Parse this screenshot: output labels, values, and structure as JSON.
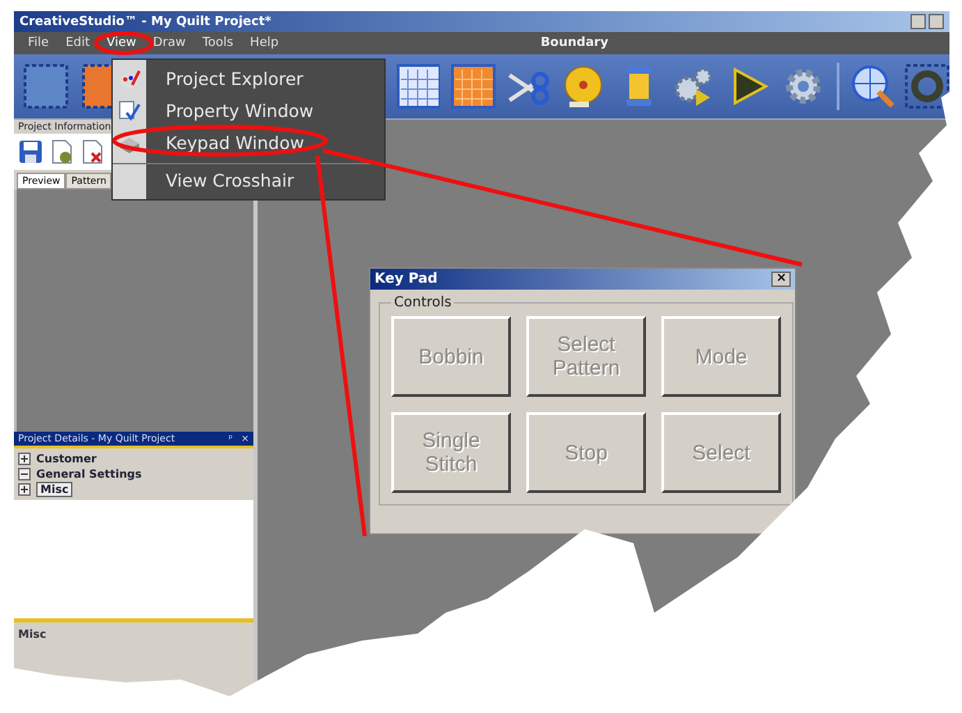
{
  "window": {
    "title": "CreativeStudio™ - My Quilt Project*"
  },
  "menu": [
    {
      "label": "File",
      "selected": false
    },
    {
      "label": "Edit",
      "selected": false
    },
    {
      "label": "View",
      "selected": true
    },
    {
      "label": "Draw",
      "selected": false
    },
    {
      "label": "Tools",
      "selected": false
    },
    {
      "label": "Help",
      "selected": false
    }
  ],
  "toolbar_caption": "Boundary",
  "view_menu": [
    {
      "label": "Project Explorer",
      "kind": "palette"
    },
    {
      "label": "Property Window",
      "kind": "property"
    },
    {
      "label": "Keypad Window",
      "kind": "keypad"
    },
    {
      "label": "View Crosshair",
      "kind": "plain"
    }
  ],
  "project_panel": {
    "title": "Project Information",
    "tabs": [
      {
        "label": "Preview",
        "selected": true
      },
      {
        "label": "Pattern",
        "selected": false
      }
    ]
  },
  "details_panel": {
    "title": "Project Details - My Quilt Project",
    "pin": "ᵖ",
    "close": "×",
    "items": [
      {
        "label": "Customer",
        "expanded": false,
        "selected": false
      },
      {
        "label": "General Settings",
        "expanded": true,
        "selected": false
      },
      {
        "label": "Misc",
        "expanded": false,
        "selected": true
      }
    ],
    "footer": "Misc"
  },
  "keypad": {
    "title": "Key Pad",
    "close": "×",
    "group": "Controls",
    "buttons": [
      {
        "label": "Bobbin",
        "disabled": true
      },
      {
        "label": "Select Pattern",
        "disabled": true
      },
      {
        "label": "Mode",
        "disabled": true
      },
      {
        "label": "Single Stitch",
        "disabled": true
      },
      {
        "label": "Stop",
        "disabled": true
      },
      {
        "label": "Select",
        "disabled": true
      }
    ]
  }
}
